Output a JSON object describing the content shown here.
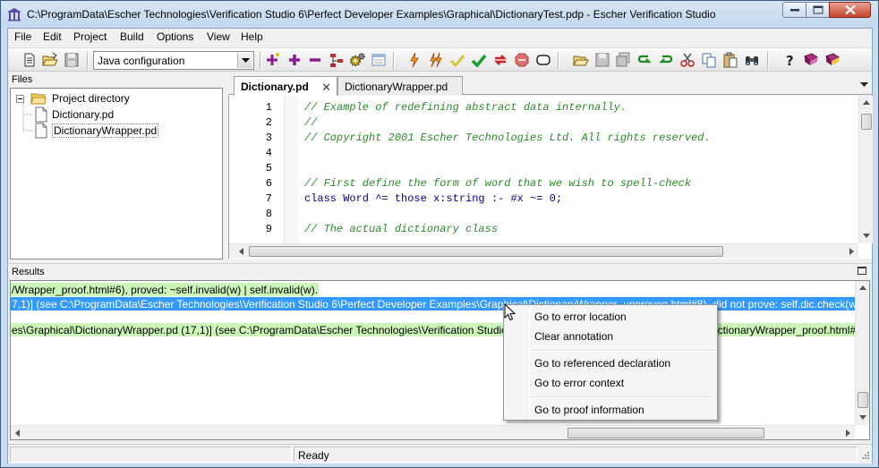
{
  "window": {
    "title": "C:\\ProgramData\\Escher Technologies\\Verification Studio 6\\Perfect Developer Examples\\Graphical\\DictionaryTest.pdp - Escher Verification Studio"
  },
  "menubar": [
    "File",
    "Edit",
    "Project",
    "Build",
    "Options",
    "View",
    "Help"
  ],
  "toolbar": {
    "configuration": "Java configuration"
  },
  "files_panel": {
    "header": "Files",
    "root": "Project directory",
    "items": [
      "Dictionary.pd",
      "DictionaryWrapper.pd"
    ]
  },
  "editor": {
    "tabs": [
      {
        "label": "Dictionary.pd",
        "active": true
      },
      {
        "label": "DictionaryWrapper.pd",
        "active": false
      }
    ],
    "lines": [
      {
        "no": "1",
        "text": "// Example of redefining abstract data internally."
      },
      {
        "no": "2",
        "text": "//"
      },
      {
        "no": "3",
        "text": "// Copyright 2001 Escher Technologies Ltd. All rights reserved."
      },
      {
        "no": "4",
        "text": ""
      },
      {
        "no": "5",
        "text": ""
      },
      {
        "no": "6",
        "text": "// First define the form of word that we wish to spell-check"
      },
      {
        "no": "7",
        "text": "class Word ^= those x:string :- #x ~= 0;"
      },
      {
        "no": "8",
        "text": ""
      },
      {
        "no": "9",
        "text": "// The actual dictionary class"
      }
    ]
  },
  "results": {
    "header": "Results",
    "lines": [
      {
        "text": "/Wrapper_proof.html#6), proved: ~self.invalid(w) | self.invalid(w).",
        "style": "green"
      },
      {
        "text": "7,1)] (see C:\\ProgramData\\Escher Technologies\\Verification Studio 6\\Perfect Developer Examples\\Graphical\\DictionaryWrapper_unproven.html#8), did not prove: self.dic.check(w).",
        "style": "selected"
      },
      {
        "text": "es\\Graphical\\DictionaryWrapper.pd (17,1)] (see C:\\ProgramData\\Escher Technologies\\Verification Studio 6\\Perfect Developer Examples\\Graphical\\DictionaryWrapper_proof.html#7)",
        "style": "green"
      }
    ]
  },
  "context_menu": {
    "groups": [
      [
        "Go to error location",
        "Clear annotation"
      ],
      [
        "Go to referenced declaration",
        "Go to error context"
      ],
      [
        "Go to proof information"
      ]
    ]
  },
  "status": {
    "text": "Ready"
  }
}
